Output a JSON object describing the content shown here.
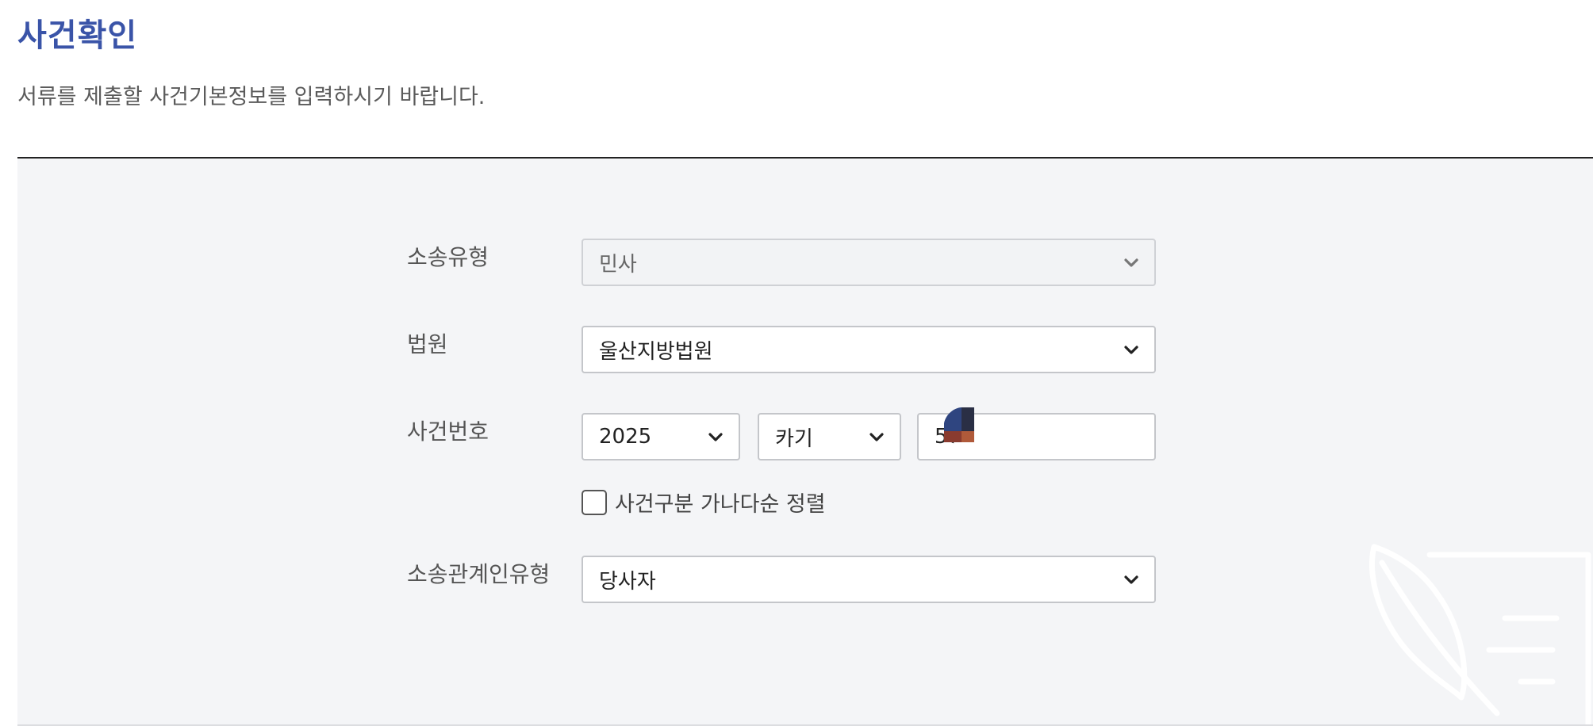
{
  "header": {
    "title": "사건확인",
    "description": "서류를 제출할 사건기본정보를 입력하시기 바랍니다."
  },
  "form": {
    "litigation_type": {
      "label": "소송유형",
      "value": "민사"
    },
    "court": {
      "label": "법원",
      "value": "울산지방법원"
    },
    "case_number": {
      "label": "사건번호",
      "year": "2025",
      "category": "카기",
      "number": "56"
    },
    "sort_option": {
      "label": "사건구분 가나다순 정렬",
      "checked": false
    },
    "party_type": {
      "label": "소송관계인유형",
      "value": "당사자"
    }
  },
  "icons": {
    "dropdown": "chevron-down-icon",
    "decoration": "quill-document-icon"
  },
  "colors": {
    "title": "#3a54a8",
    "panel_bg": "#f4f5f7"
  }
}
